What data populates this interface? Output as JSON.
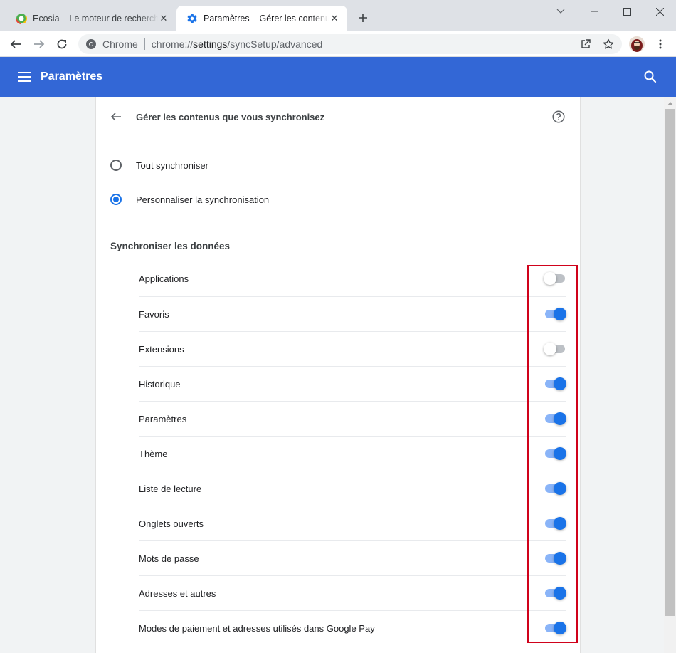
{
  "tabs": [
    {
      "title": "Ecosia – Le moteur de recherche qui plante des arbres",
      "icon": "ecosia-favicon-icon",
      "active": false
    },
    {
      "title": "Paramètres – Gérer les contenus que vous synchronisez",
      "icon": "settings-gear-icon",
      "active": true
    }
  ],
  "omnibox": {
    "site_label": "Chrome",
    "url_prefix": "chrome://",
    "url_host": "settings",
    "url_path": "/syncSetup/advanced"
  },
  "header": {
    "title": "Paramètres"
  },
  "subpage": {
    "title": "Gérer les contenus que vous synchronisez"
  },
  "sync_mode": {
    "options": [
      {
        "label": "Tout synchroniser",
        "checked": false
      },
      {
        "label": "Personnaliser la synchronisation",
        "checked": true
      }
    ]
  },
  "sync_data": {
    "section_title": "Synchroniser les données",
    "items": [
      {
        "label": "Applications",
        "enabled": false
      },
      {
        "label": "Favoris",
        "enabled": true
      },
      {
        "label": "Extensions",
        "enabled": false
      },
      {
        "label": "Historique",
        "enabled": true
      },
      {
        "label": "Paramètres",
        "enabled": true
      },
      {
        "label": "Thème",
        "enabled": true
      },
      {
        "label": "Liste de lecture",
        "enabled": true
      },
      {
        "label": "Onglets ouverts",
        "enabled": true
      },
      {
        "label": "Mots de passe",
        "enabled": true
      },
      {
        "label": "Adresses et autres",
        "enabled": true
      },
      {
        "label": "Modes de paiement et adresses utilisés dans Google Pay",
        "enabled": true
      }
    ]
  },
  "colors": {
    "header_blue": "#3367d6",
    "toggle_on": "#1a73e8",
    "toggle_on_track": "#8ab4f8",
    "highlight_red": "#d0021b"
  }
}
